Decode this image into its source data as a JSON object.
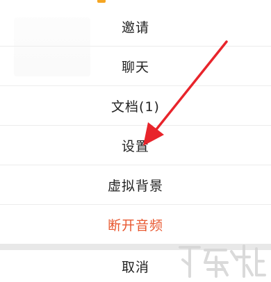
{
  "menu": {
    "items": [
      {
        "label": "邀请"
      },
      {
        "label": "聊天"
      },
      {
        "label": "文档(1)"
      },
      {
        "label": "设置"
      },
      {
        "label": "虚拟背景"
      },
      {
        "label": "断开音频"
      }
    ],
    "cancel_label": "取消"
  },
  "colors": {
    "danger": "#e8572f",
    "arrow": "#e8242b",
    "accent": "#f5a623",
    "text": "#222222"
  },
  "icons": {
    "annotation": "red-arrow-icon",
    "watermark": "site-logo-watermark"
  }
}
